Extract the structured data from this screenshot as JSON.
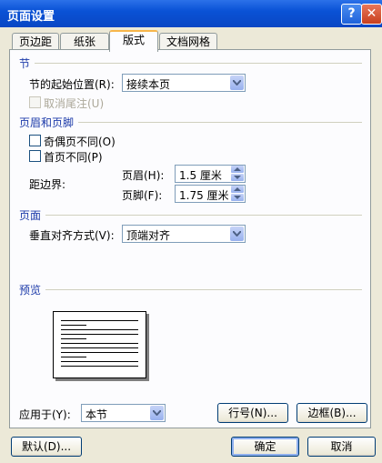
{
  "window": {
    "title": "页面设置",
    "help": "?",
    "close": "✕"
  },
  "tabs": [
    "页边距",
    "纸张",
    "版式",
    "文档网格"
  ],
  "section": {
    "title": "节",
    "start_label": "节的起始位置(R):",
    "start_value": "接续本页",
    "suppress_endnotes": "取消尾注(U)"
  },
  "header_footer": {
    "title": "页眉和页脚",
    "odd_even": "奇偶页不同(O)",
    "first_page": "首页不同(P)",
    "from_edge": "距边界:",
    "header_label": "页眉(H):",
    "header_value": "1.5 厘米",
    "footer_label": "页脚(F):",
    "footer_value": "1.75 厘米"
  },
  "page": {
    "title": "页面",
    "valign_label": "垂直对齐方式(V):",
    "valign_value": "顶端对齐"
  },
  "preview": {
    "title": "预览"
  },
  "apply": {
    "label": "应用于(Y):",
    "value": "本节"
  },
  "buttons": {
    "line_numbers": "行号(N)...",
    "borders": "边框(B)...",
    "default": "默认(D)...",
    "ok": "确定",
    "cancel": "取消"
  }
}
